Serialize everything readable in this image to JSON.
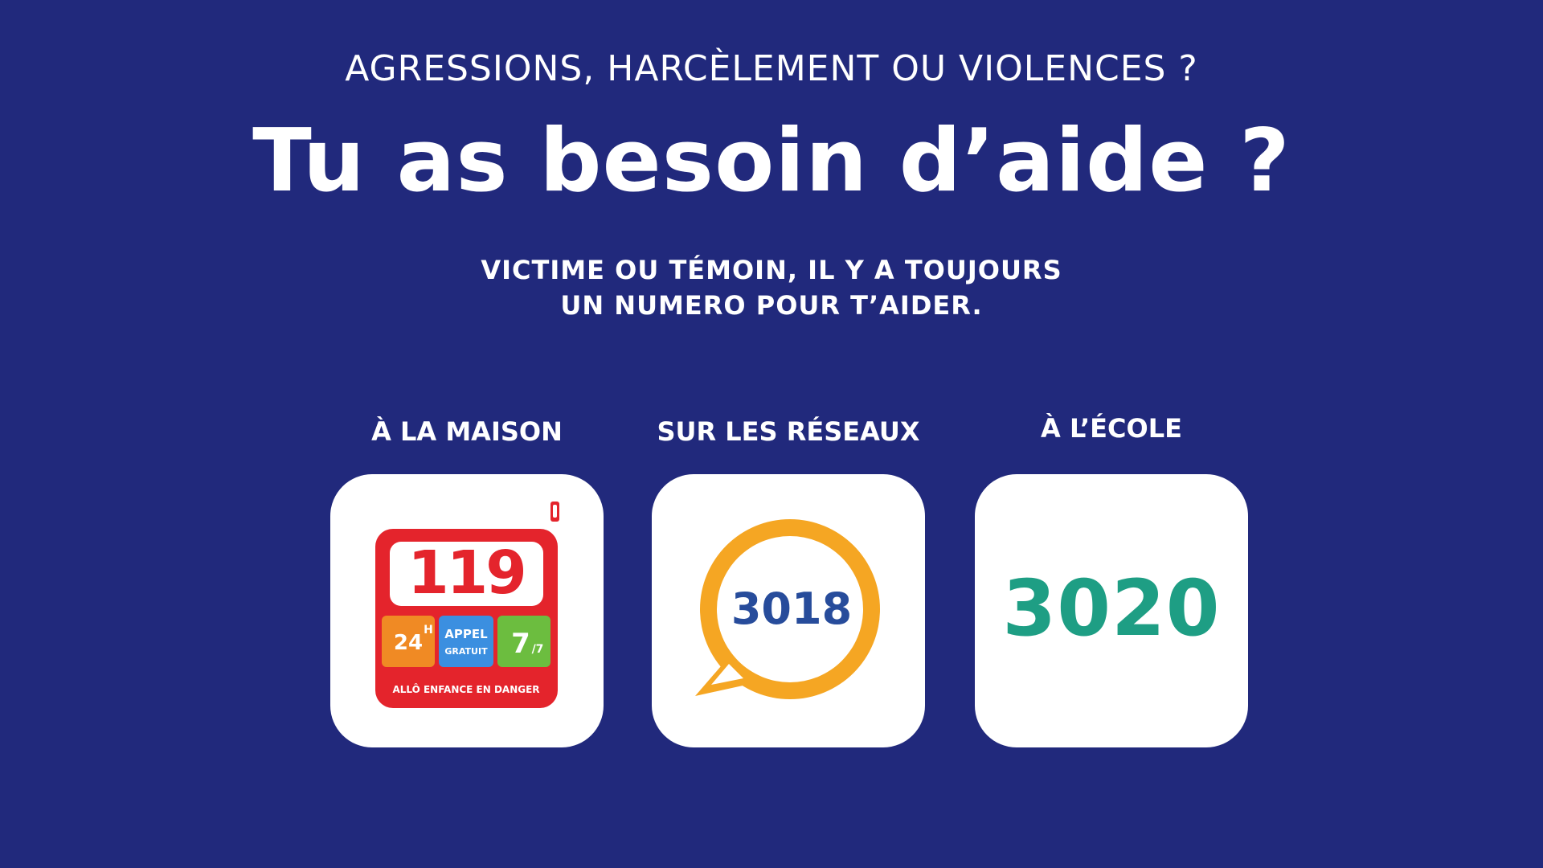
{
  "kicker": "AGRESSIONS, HARCÈLEMENT OU VIOLENCES ?",
  "headline": "Tu as besoin d’aide ?",
  "subtitle": {
    "line1": "VICTIME OU TÉMOIN, IL Y A TOUJOURS",
    "line2": "UN NUMERO POUR T’AIDER."
  },
  "columns": [
    {
      "label": "À LA MAISON",
      "logo": {
        "number": "119",
        "badges": [
          "24H",
          "APPEL GRATUIT",
          "7/7"
        ],
        "tagline": "ALLÔ ENFANCE EN DANGER"
      }
    },
    {
      "label": "SUR LES RÉSEAUX",
      "logo": {
        "number": "3018"
      }
    },
    {
      "label": "À L’ÉCOLE",
      "logo": {
        "number": "3020"
      }
    }
  ],
  "colors": {
    "background": "#21297c",
    "red_119": "#e4242c",
    "orange_3018": "#f5a623",
    "blue_3018": "#274c9b",
    "green_3020": "#1e9e84"
  }
}
